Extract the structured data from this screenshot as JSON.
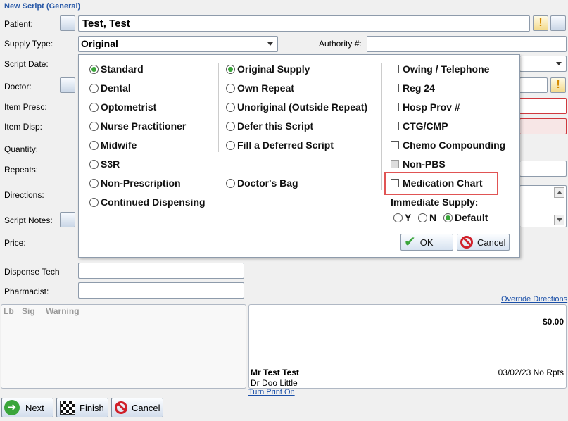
{
  "window": {
    "title": "New Script (General)"
  },
  "labels": {
    "patient": "Patient:",
    "supply_type": "Supply Type:",
    "authority": "Authority #:",
    "script_date": "Script Date:",
    "doctor": "Doctor:",
    "item_presc": "Item Presc:",
    "item_disp": "Item Disp:",
    "quantity": "Quantity:",
    "repeats": "Repeats:",
    "directions": "Directions:",
    "script_notes": "Script Notes:",
    "price": "Price:",
    "dispense_tech": "Dispense Tech",
    "pharmacist": "Pharmacist:"
  },
  "fields": {
    "patient_value": "Test, Test",
    "supply_type_value": "Original"
  },
  "popup": {
    "col1": [
      "Standard",
      "Dental",
      "Optometrist",
      "Nurse Practitioner",
      "Midwife",
      "S3R",
      "Non-Prescription",
      "Continued Dispensing"
    ],
    "col1_selected": "Standard",
    "col2": [
      "Original Supply",
      "Own Repeat",
      "Unoriginal (Outside Repeat)",
      "Defer this Script",
      "Fill a Deferred Script",
      "Doctor's Bag"
    ],
    "col2_selected": "Original Supply",
    "col3": [
      "Owing / Telephone",
      "Reg 24",
      "Hosp Prov #",
      "CTG/CMP",
      "Chemo Compounding",
      "Non-PBS",
      "Medication Chart"
    ],
    "immediate_supply_label": "Immediate Supply:",
    "immediate_options": [
      "Y",
      "N",
      "Default"
    ],
    "immediate_selected": "Default",
    "ok_label": "OK",
    "cancel_label": "Cancel"
  },
  "lower": {
    "override_directions": "Override Directions",
    "col_headers": [
      "Lb",
      "Sig",
      "Warning"
    ],
    "price_total": "$0.00",
    "patient_name": "Mr Test Test",
    "doctor_name": "Dr Doo Little",
    "date_rpts": "03/02/23 No Rpts",
    "turn_print_on": "Turn Print On"
  },
  "footer": {
    "next_label": "Next",
    "finish_label": "Finish",
    "cancel_label": "Cancel"
  }
}
